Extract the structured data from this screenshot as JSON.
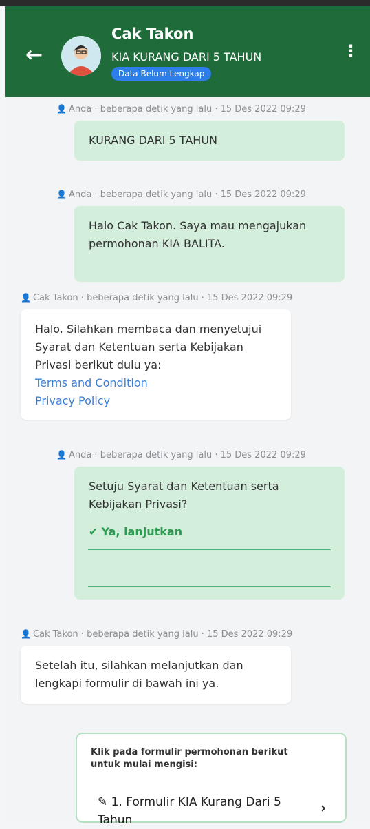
{
  "header": {
    "title": "Cak Takon",
    "subtitle": "KIA KURANG DARI 5 TAHUN",
    "badge": "Data Belum Lengkap",
    "back_icon": "arrow-left-icon",
    "menu_icon": "kebab-menu-icon"
  },
  "messages": [
    {
      "sender": "Anda",
      "meta": "Anda · beberapa detik yang lalu · 15 Des 2022 09:29",
      "text": "KURANG DARI 5 TAHUN"
    },
    {
      "sender": "Anda",
      "meta": "Anda · beberapa detik yang lalu · 15 Des 2022 09:29",
      "text": "Halo Cak Takon. Saya mau mengajukan permohonan KIA BALITA."
    },
    {
      "sender": "Cak Takon",
      "meta": "Cak Takon · beberapa detik yang lalu · 15 Des 2022 09:29",
      "text": "Halo. Silahkan membaca dan menyetujui Syarat dan Ketentuan serta Kebijakan Privasi berikut dulu ya:",
      "links": [
        "Terms and Condition",
        "Privacy Policy"
      ]
    },
    {
      "sender": "Anda",
      "meta": "Anda · beberapa detik yang lalu · 15 Des 2022 09:29",
      "text": "Setuju Syarat dan Ketentuan serta Kebijakan Privasi?",
      "answer": "Ya, lanjutkan"
    },
    {
      "sender": "Cak Takon",
      "meta": "Cak Takon · beberapa detik yang lalu · 15 Des 2022 09:29",
      "text": "Setelah itu, silahkan melanjutkan dan lengkapi formulir di bawah ini ya."
    }
  ],
  "form_card": {
    "intro": "Klik pada formulir permohonan berikut untuk mulai mengisi:",
    "item": "1. Formulir KIA Kurang Dari 5 Tahun"
  },
  "colors": {
    "header": "#1f6b3a",
    "outgoing": "#d4eedc",
    "link": "#3a7fd4",
    "badge": "#2d7ee8"
  }
}
